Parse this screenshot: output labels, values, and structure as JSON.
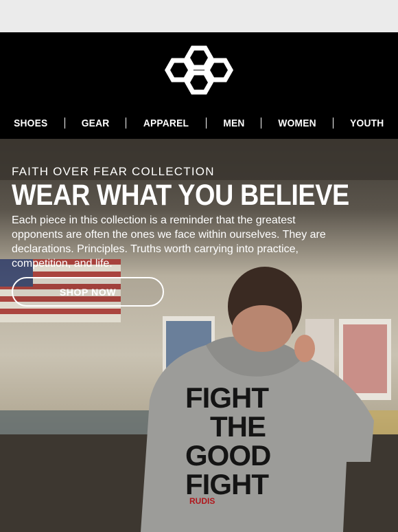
{
  "brand": {
    "logo_icon": "hexagon-cluster-logo-icon"
  },
  "nav": {
    "items": [
      {
        "label": "SHOES"
      },
      {
        "label": "GEAR"
      },
      {
        "label": "APPAREL"
      },
      {
        "label": "MEN"
      },
      {
        "label": "WOMEN"
      },
      {
        "label": "YOUTH"
      }
    ]
  },
  "hero": {
    "eyebrow": "FAITH OVER FEAR COLLECTION",
    "headline": "WEAR WHAT YOU BELIEVE",
    "body": "Each piece in this collection is a reminder that the greatest opponents are often the ones we face within ourselves. They are declarations. Principles. Truths worth carrying into practice, competition, and life.",
    "cta_label": "SHOP NOW",
    "image": {
      "hoodie_text": [
        "FIGHT",
        "THE",
        "GOOD",
        "FIGHT"
      ],
      "hoodie_logo_text": "RUDIS"
    }
  },
  "colors": {
    "header_bg": "#000000",
    "text": "#ffffff",
    "hoodie": "#9c9c99"
  }
}
